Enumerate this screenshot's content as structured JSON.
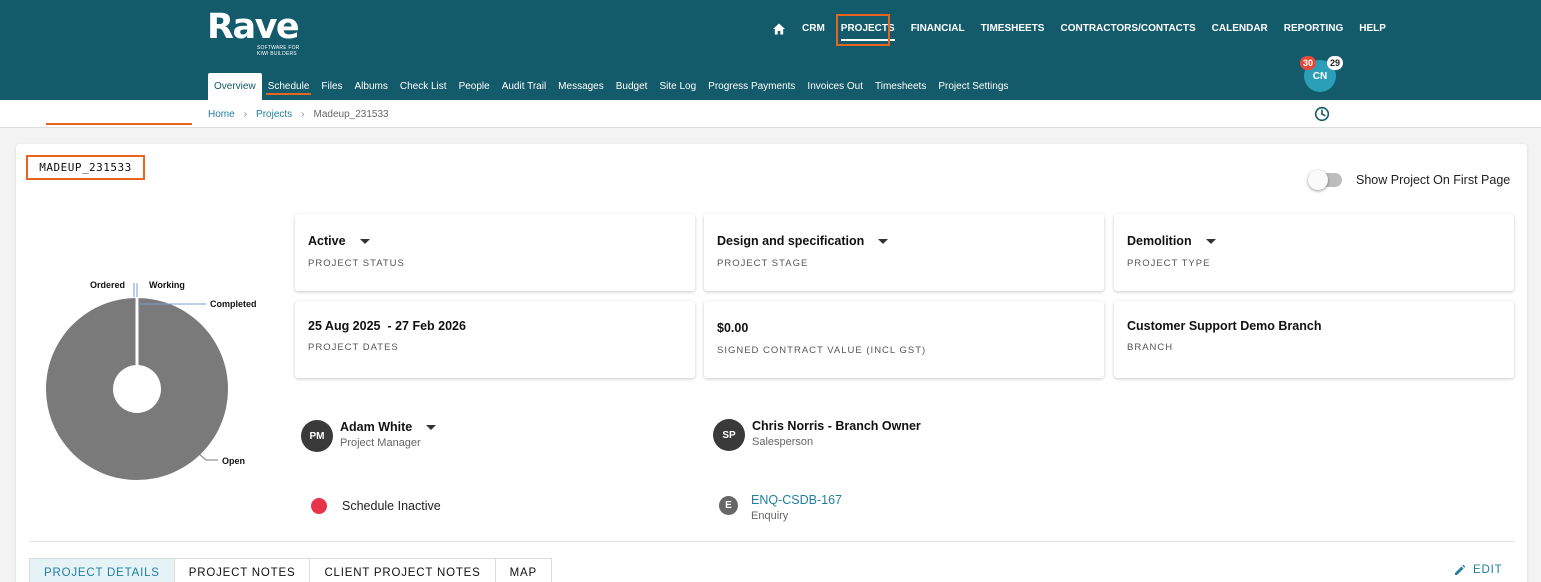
{
  "brand": {
    "name": "Rave",
    "tagline": "Software for Kiwi Builders"
  },
  "main_nav": [
    "CRM",
    "PROJECTS",
    "FINANCIAL",
    "TIMESHEETS",
    "CONTRACTORS/CONTACTS",
    "CALENDAR",
    "REPORTING",
    "HELP"
  ],
  "sub_nav": [
    "Overview",
    "Schedule",
    "Files",
    "Albums",
    "Check List",
    "People",
    "Audit Trail",
    "Messages",
    "Budget",
    "Site Log",
    "Progress Payments",
    "Invoices Out",
    "Timesheets",
    "Project Settings"
  ],
  "user": {
    "initials": "CN",
    "badge_left": "30",
    "badge_right": "29"
  },
  "breadcrumb": {
    "home": "Home",
    "projects": "Projects",
    "current": "Madeup_231533"
  },
  "project": {
    "title": "MADEUP_231533"
  },
  "toggle": {
    "label": "Show Project On First Page",
    "on": false
  },
  "chart_data": {
    "type": "pie",
    "categories": [
      "Ordered",
      "Working",
      "Completed",
      "Open"
    ],
    "values": [
      0,
      0,
      0,
      100
    ],
    "colors": [
      "#7a7a7a",
      "#7a7a7a",
      "#7a7a7a",
      "#7a7a7a"
    ]
  },
  "info_cards": {
    "status": {
      "value": "Active",
      "label": "PROJECT STATUS"
    },
    "stage": {
      "value": "Design and specification",
      "label": "PROJECT STAGE"
    },
    "type": {
      "value": "Demolition",
      "label": "PROJECT TYPE"
    },
    "dates": {
      "value": "25 Aug 2025  - 27 Feb 2026",
      "label": "PROJECT DATES"
    },
    "contract": {
      "value": "$0.00",
      "label": "SIGNED CONTRACT VALUE (INCL GST)"
    },
    "branch": {
      "value": "Customer Support Demo Branch",
      "label": "BRANCH"
    }
  },
  "people": {
    "pm": {
      "initials": "PM",
      "name": "Adam White",
      "role": "Project Manager"
    },
    "sp": {
      "initials": "SP",
      "name": "Chris Norris - Branch Owner",
      "role": "Salesperson"
    }
  },
  "schedule": {
    "label": "Schedule Inactive",
    "status_color": "#e8334a"
  },
  "enquiry": {
    "icon_letter": "E",
    "id": "ENQ-CSDB-167",
    "label": "Enquiry"
  },
  "tabs": [
    "PROJECT DETAILS",
    "PROJECT NOTES",
    "CLIENT PROJECT NOTES",
    "MAP"
  ],
  "edit_label": "EDIT",
  "colors": {
    "header": "#135a6b",
    "accent": "#e8651f",
    "link": "#1f7fa0"
  }
}
